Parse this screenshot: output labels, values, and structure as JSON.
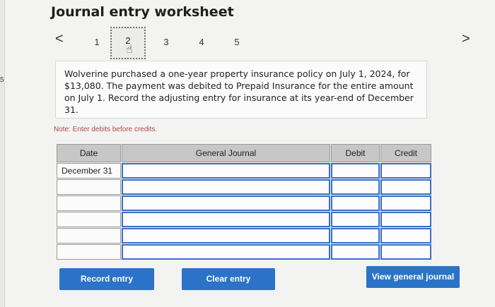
{
  "title": "Journal entry worksheet",
  "edge_char": "5",
  "pagination": {
    "prev": "<",
    "next": ">",
    "pages": [
      "1",
      "2",
      "3",
      "4",
      "5"
    ],
    "active": "2"
  },
  "problem": "Wolverine purchased a one-year property insurance policy on July 1, 2024, for $13,080. The payment was debited to Prepaid Insurance for the entire amount on July 1. Record the adjusting entry for insurance at its year-end of December 31.",
  "note": "Note: Enter debits before credits.",
  "table": {
    "headers": {
      "date": "Date",
      "gj": "General Journal",
      "debit": "Debit",
      "credit": "Credit"
    },
    "rows": [
      {
        "date": "December 31"
      },
      {
        "date": ""
      },
      {
        "date": ""
      },
      {
        "date": ""
      },
      {
        "date": ""
      },
      {
        "date": ""
      }
    ]
  },
  "buttons": {
    "record": "Record entry",
    "clear": "Clear entry",
    "view": "View general journal"
  }
}
